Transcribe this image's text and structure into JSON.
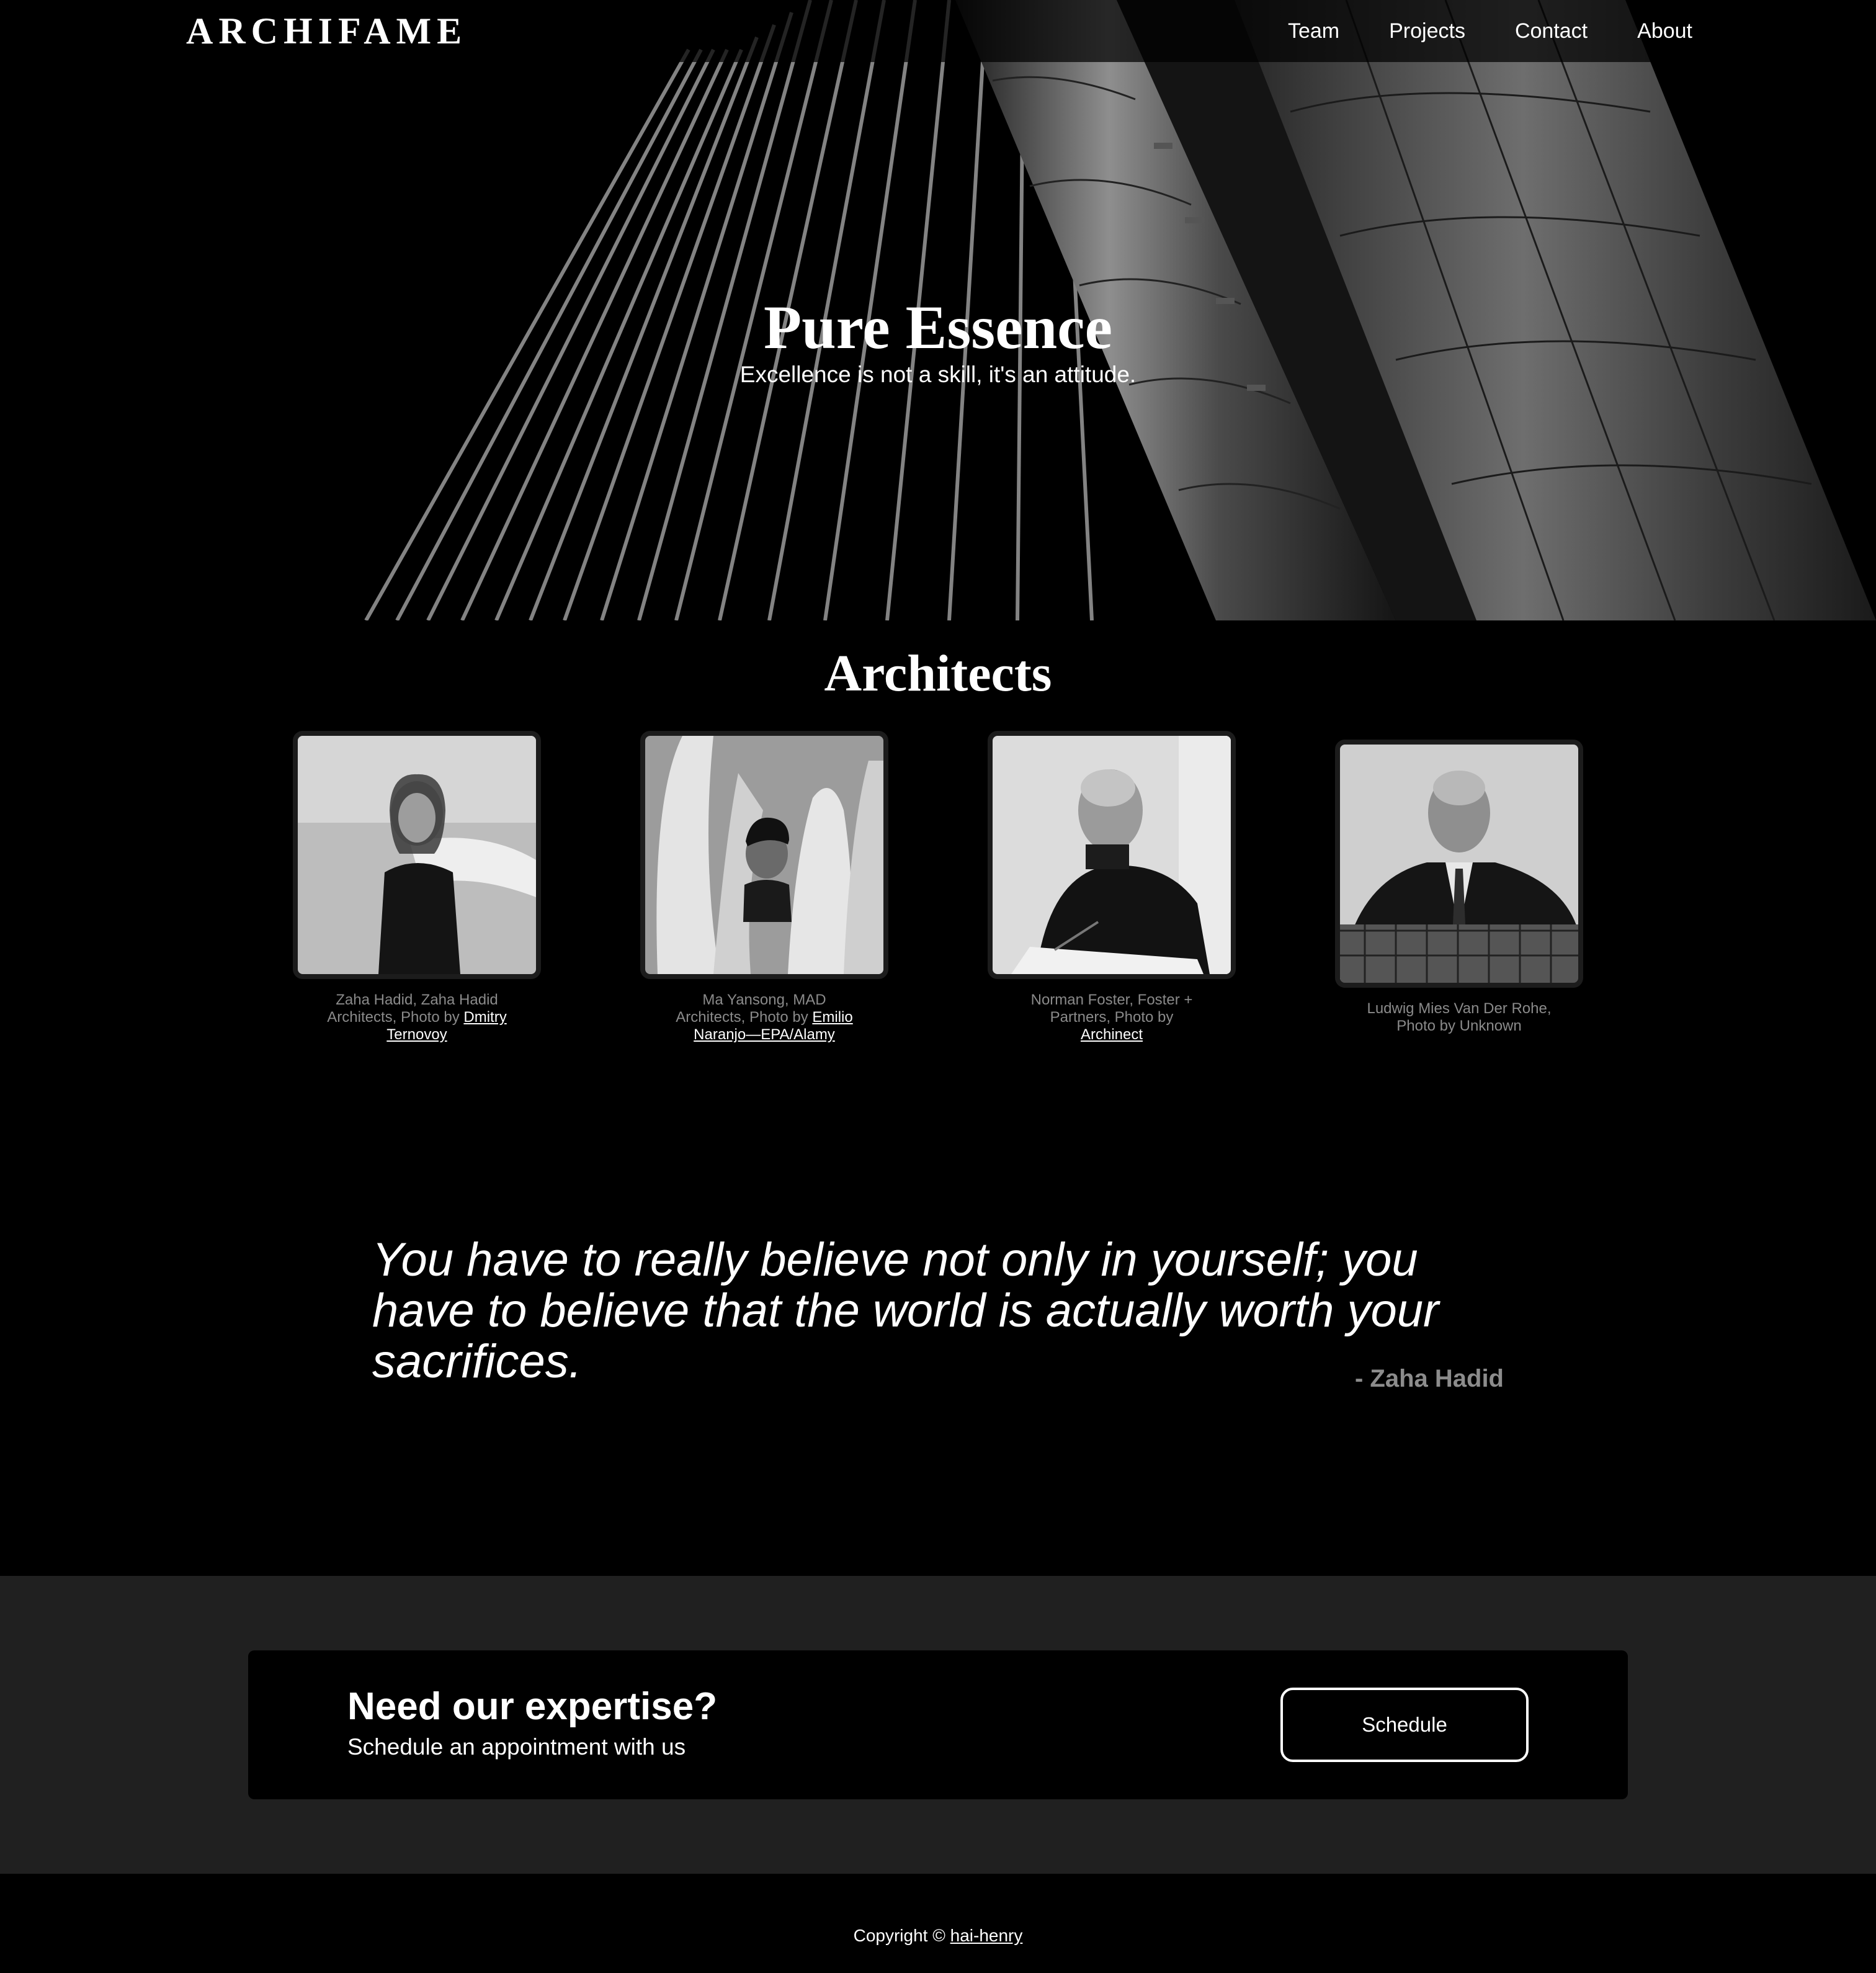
{
  "brand": "ARCHIFAME",
  "nav": [
    "Team",
    "Projects",
    "Contact",
    "About"
  ],
  "hero": {
    "title": "Pure Essence",
    "subtitle": "Excellence is not a skill, it's an attitude."
  },
  "architects": {
    "title": "Architects",
    "cards": [
      {
        "caption_text": "Zaha Hadid, Zaha Hadid Architects, Photo by ",
        "photo_credit": "Dmitry Ternovoy"
      },
      {
        "caption_text": "Ma Yansong, MAD Architects, Photo by ",
        "photo_credit": "Emilio Naranjo—EPA/Alamy"
      },
      {
        "caption_text": "Norman Foster, Foster + Partners, Photo by ",
        "photo_credit": "Archinect"
      },
      {
        "caption_text": "Ludwig Mies Van Der Rohe, Photo by Unknown",
        "photo_credit": ""
      }
    ]
  },
  "quote": {
    "text": "You have to really believe not only in yourself; you have to believe that the world is actually worth your sacrifices.",
    "author": "- Zaha Hadid"
  },
  "cta": {
    "title": "Need our expertise?",
    "subtitle": "Schedule an appointment with us",
    "button": "Schedule"
  },
  "footer": {
    "text": "Copyright © ",
    "link": "hai-henry"
  },
  "colors": {
    "background": "#000000",
    "cta_band": "#202020",
    "caption_gray": "#8a8a8a",
    "author_gray": "#8c8c8c"
  }
}
